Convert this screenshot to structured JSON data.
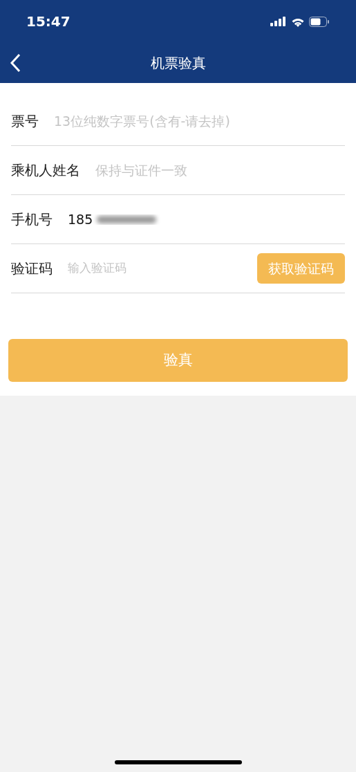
{
  "status_bar": {
    "time": "15:47"
  },
  "nav_bar": {
    "title": "机票验真"
  },
  "form": {
    "fields": [
      {
        "kind": "input",
        "label": "票号",
        "placeholder": "13位纯数字票号(含有-请去掉)"
      },
      {
        "kind": "input",
        "label": "乘机人姓名",
        "placeholder": "保持与证件一致"
      },
      {
        "kind": "phone",
        "label": "手机号",
        "value": "185"
      },
      {
        "kind": "code",
        "label": "验证码",
        "placeholder": "输入验证码",
        "button": "获取验证码"
      }
    ]
  },
  "submit_button": "验真"
}
